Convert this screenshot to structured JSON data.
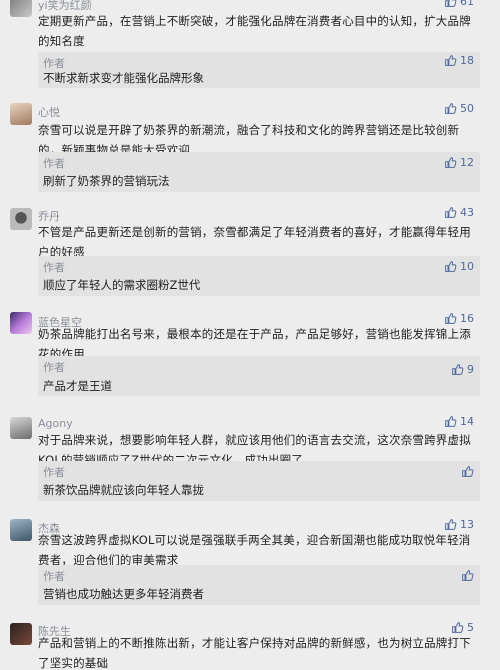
{
  "comments": [
    {
      "name": "yi笑为红颜",
      "likes": "61",
      "text": [
        "定期更新产品，在营销上不断突破，才能强化品牌在消费者心目中的认知，扩大品牌",
        "的知名度"
      ],
      "reply": {
        "author": "作者",
        "text": "不断求新求变才能强化品牌形象",
        "likes": "18"
      }
    },
    {
      "name": "心悦",
      "likes": "50",
      "text": [
        "奈雪可以说是开辟了奶茶界的新潮流，融合了科技和文化的跨界营销还是比较创新",
        "的，新颖事物总是能大受欢迎"
      ],
      "reply": {
        "author": "作者",
        "text": "刷新了奶茶界的营销玩法",
        "likes": "12"
      }
    },
    {
      "name": "乔丹",
      "likes": "43",
      "text": [
        "不管是产品更新还是创新的营销，奈雪都满足了年轻消费者的喜好，才能赢得年轻用",
        "户的好感"
      ],
      "reply": {
        "author": "作者",
        "text": "顺应了年轻人的需求圈粉Z世代",
        "likes": "10"
      }
    },
    {
      "name": "蓝色星空",
      "likes": "16",
      "text": [
        "奶茶品牌能打出名号来，最根本的还是在于产品，产品足够好，营销也能发挥锦上添",
        "花的作用"
      ],
      "reply": {
        "author": "作者",
        "text": "产品才是王道",
        "likes": "9"
      }
    },
    {
      "name": "Agony",
      "likes": "14",
      "text": [
        "对于品牌来说，想要影响年轻人群，就应该用他们的语言去交流，这次奈雪跨界虚拟",
        "KOL的营销顺应了Z世代的二次元文化，成功出圈了"
      ],
      "reply": {
        "author": "作者",
        "text": "新茶饮品牌就应该向年轻人靠拢",
        "likes": ""
      }
    },
    {
      "name": "杰森",
      "likes": "13",
      "text": [
        "奈雪这波跨界虚拟KOL可以说是强强联手两全其美，迎合新国潮也能成功取悦年轻消",
        "费者，迎合他们的审美需求"
      ],
      "reply": {
        "author": "作者",
        "text": "营销也成功触达更多年轻消费者",
        "likes": ""
      }
    },
    {
      "name": "陈先生",
      "likes": "5",
      "text": [
        "产品和营销上的不断推陈出新，才能让客户保持对品牌的新鲜感，也为树立品牌打下",
        "了坚实的基础"
      ],
      "reply": null
    }
  ],
  "colors": {
    "background": "#ededed",
    "reply_bg": "#e2e2e2",
    "like": "#4d6aa0",
    "name": "#8a8f99"
  },
  "icons": {
    "like": "thumbs-up-icon"
  }
}
